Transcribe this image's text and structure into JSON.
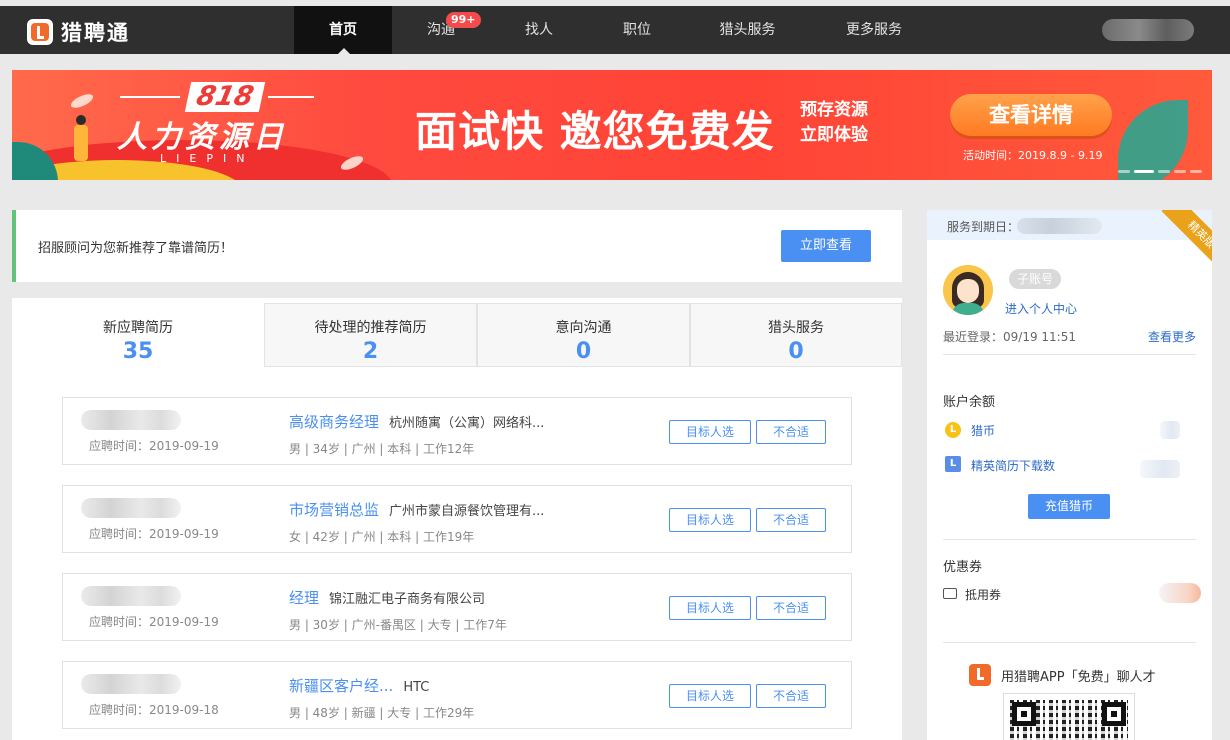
{
  "app": {
    "name": "猎聘通"
  },
  "nav": {
    "items": [
      {
        "label": "首页",
        "active": true
      },
      {
        "label": "沟通",
        "badge": "99+"
      },
      {
        "label": "找人"
      },
      {
        "label": "职位"
      },
      {
        "label": "猎头服务"
      },
      {
        "label": "更多服务"
      }
    ]
  },
  "banner": {
    "badge": "818",
    "title": "人力资源日",
    "brand": "LIEPIN",
    "headline": "面试快 邀您免费发",
    "sub_line1": "预存资源",
    "sub_line2": "立即体验",
    "cta": "查看详情",
    "time": "活动时间：2019.8.9 - 9.19"
  },
  "notice": {
    "text": "招服顾问为您新推荐了靠谱简历！",
    "button": "立即查看"
  },
  "tabs": [
    {
      "label": "新应聘简历",
      "count": "35",
      "active": true
    },
    {
      "label": "待处理的推荐简历",
      "count": "2"
    },
    {
      "label": "意向沟通",
      "count": "0"
    },
    {
      "label": "猎头服务",
      "count": "0"
    }
  ],
  "resumes": [
    {
      "apply_time": "应聘时间：2019-09-19",
      "title": "高级商务经理",
      "company": "杭州随寓（公寓）网络科...",
      "meta": "男 | 34岁 | 广州 | 本科 | 工作12年"
    },
    {
      "apply_time": "应聘时间：2019-09-19",
      "title": "市场营销总监",
      "company": "广州市蒙自源餐饮管理有...",
      "meta": "女 | 42岁 | 广州 | 本科 | 工作19年"
    },
    {
      "apply_time": "应聘时间：2019-09-19",
      "title": "经理",
      "company": "锦江融汇电子商务有限公司",
      "meta": "男 | 30岁 | 广州-番禺区 | 大专 | 工作7年"
    },
    {
      "apply_time": "应聘时间：2019-09-18",
      "title": "新疆区客户经...",
      "company": "HTC",
      "meta": "男 | 48岁 | 新疆 | 大专 | 工作29年"
    }
  ],
  "resume_actions": {
    "target": "目标人选",
    "reject": "不合适"
  },
  "sidebar": {
    "expire_label": "服务到期日：",
    "ribbon": "精英版",
    "sub_account": "子账号",
    "enter_center": "进入个人中心",
    "last_login": "最近登录：09/19 11:51",
    "view_more": "查看更多",
    "balance_title": "账户余额",
    "coin_label": "猎币",
    "download_label": "精英简历下载数",
    "recharge": "充值猎币",
    "coupon_title": "优惠券",
    "voucher_label": "抵用券",
    "app_promo": "用猎聘APP「免费」聊人才"
  },
  "colors": {
    "accent": "#4a8ff2",
    "nav_bg": "#2f2f2f",
    "banner": "#ff4336",
    "ribbon": "#e9a21a",
    "notice_bar": "#64c37a"
  }
}
